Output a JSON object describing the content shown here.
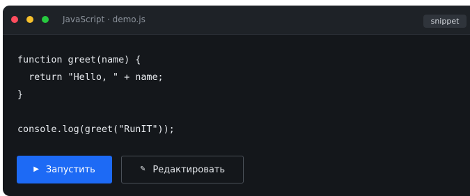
{
  "window": {
    "title": "JavaScript · demo.js",
    "badge": "snippet"
  },
  "code": {
    "lines": [
      "function greet(name) {",
      "  return \"Hello, \" + name;",
      "}",
      "",
      "console.log(greet(\"RunIT\"));"
    ]
  },
  "actions": {
    "run_label": "Запустить",
    "edit_label": "Редактировать"
  },
  "icons": {
    "run": "play-icon",
    "edit": "pencil-icon"
  },
  "colors": {
    "accent": "#1d6af5",
    "background": "#14171b",
    "dot_red": "#ff4d5e",
    "dot_yellow": "#f6c02c",
    "dot_green": "#27c93f"
  }
}
